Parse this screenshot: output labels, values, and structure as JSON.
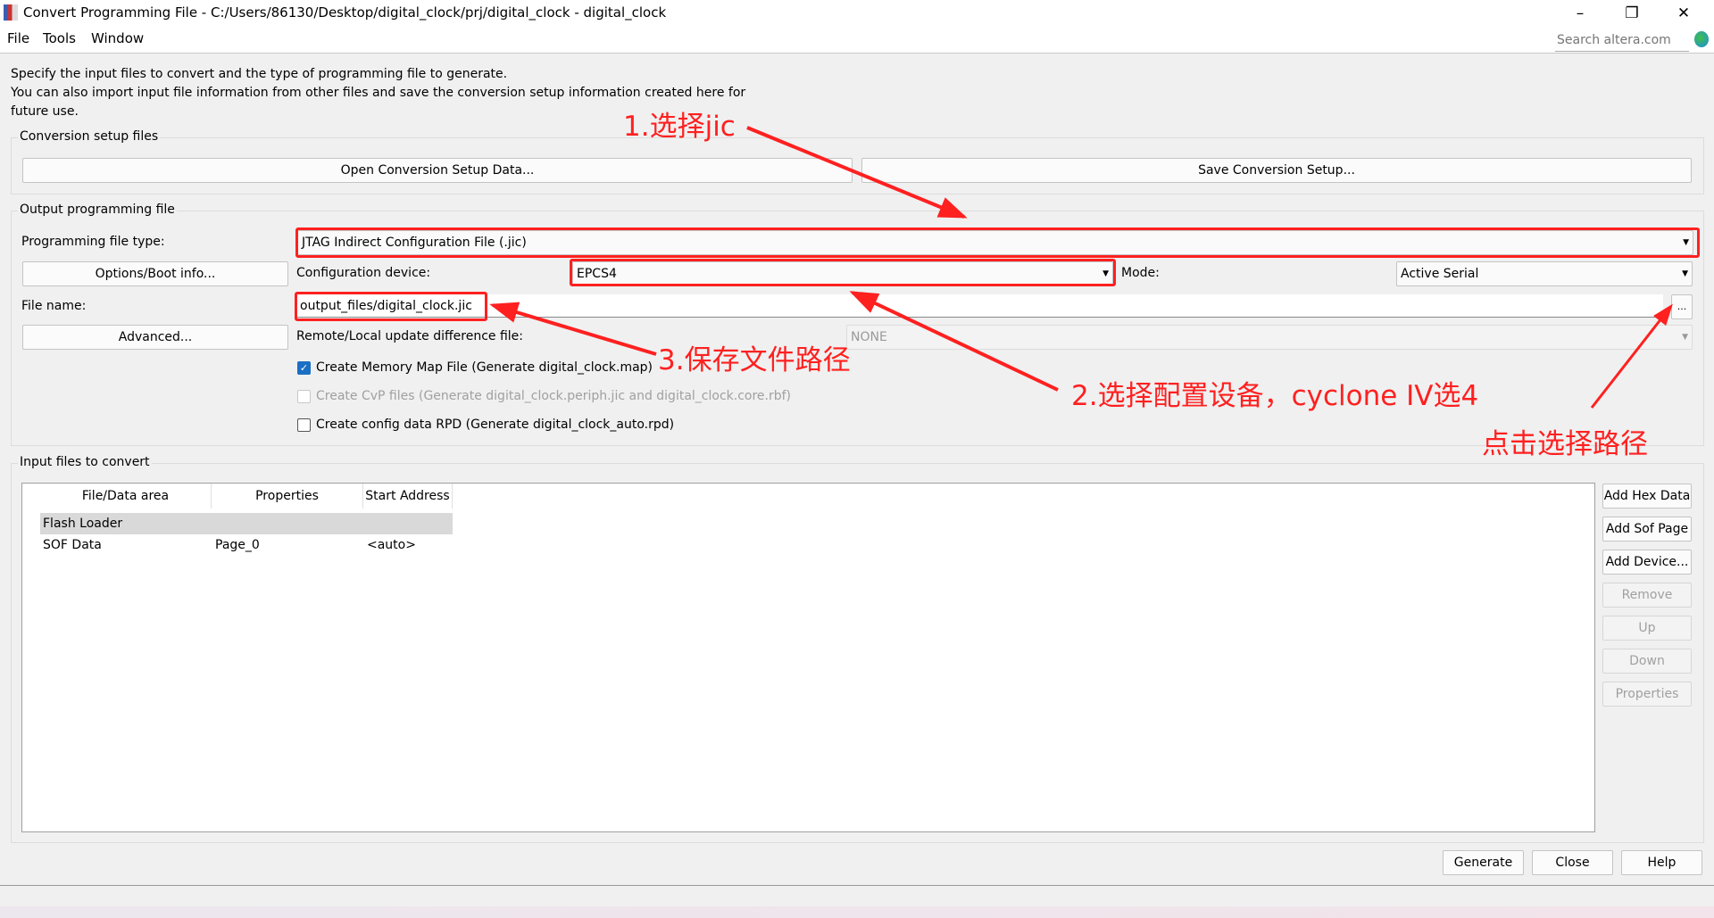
{
  "window": {
    "title": "Convert Programming File - C:/Users/86130/Desktop/digital_clock/prj/digital_clock - digital_clock",
    "search_placeholder": "Search altera.com"
  },
  "menu": [
    "File",
    "Tools",
    "Window"
  ],
  "description": [
    "Specify the input files to convert and the type of programming file to generate.",
    "You can also import input file information from other files and save the conversion setup information created here for",
    "future use."
  ],
  "setup": {
    "title": "Conversion setup files",
    "open": "Open Conversion Setup Data...",
    "save": "Save Conversion Setup..."
  },
  "output": {
    "title": "Output programming file",
    "type_label": "Programming file type:",
    "type_value": "JTAG Indirect Configuration File (.jic)",
    "options_button": "Options/Boot info...",
    "device_label": "Configuration device:",
    "device_value": "EPCS4",
    "mode_label": "Mode:",
    "mode_value": "Active Serial",
    "filename_label": "File name:",
    "filename_value": "output_files/digital_clock.jic",
    "browse": "...",
    "advanced_button": "Advanced...",
    "remote_label": "Remote/Local update difference file:",
    "remote_value": "NONE",
    "checkboxes": [
      {
        "label": "Create Memory Map File (Generate digital_clock.map)",
        "checked": true,
        "enabled": true
      },
      {
        "label": "Create CvP files (Generate digital_clock.periph.jic and digital_clock.core.rbf)",
        "checked": false,
        "enabled": false
      },
      {
        "label": "Create config data RPD (Generate digital_clock_auto.rpd)",
        "checked": false,
        "enabled": true
      }
    ]
  },
  "input": {
    "title": "Input files to convert",
    "columns": [
      "File/Data area",
      "Properties",
      "Start Address"
    ],
    "rows": [
      [
        "Flash Loader",
        "",
        ""
      ],
      [
        "SOF Data",
        "Page_0",
        "<auto>"
      ]
    ],
    "buttons": [
      {
        "label": "Add Hex Data",
        "enabled": true
      },
      {
        "label": "Add Sof Page",
        "enabled": true
      },
      {
        "label": "Add Device...",
        "enabled": true
      },
      {
        "label": "Remove",
        "enabled": false
      },
      {
        "label": "Up",
        "enabled": false
      },
      {
        "label": "Down",
        "enabled": false
      },
      {
        "label": "Properties",
        "enabled": false
      }
    ]
  },
  "footer": {
    "generate": "Generate",
    "close": "Close",
    "help": "Help"
  },
  "annotations": {
    "a1": "1.选择jic",
    "a2": "2.选择配置设备，cyclone IV选4",
    "a3": "3.保存文件路径",
    "a4": "点击选择路径",
    "color": "#ff2020"
  }
}
